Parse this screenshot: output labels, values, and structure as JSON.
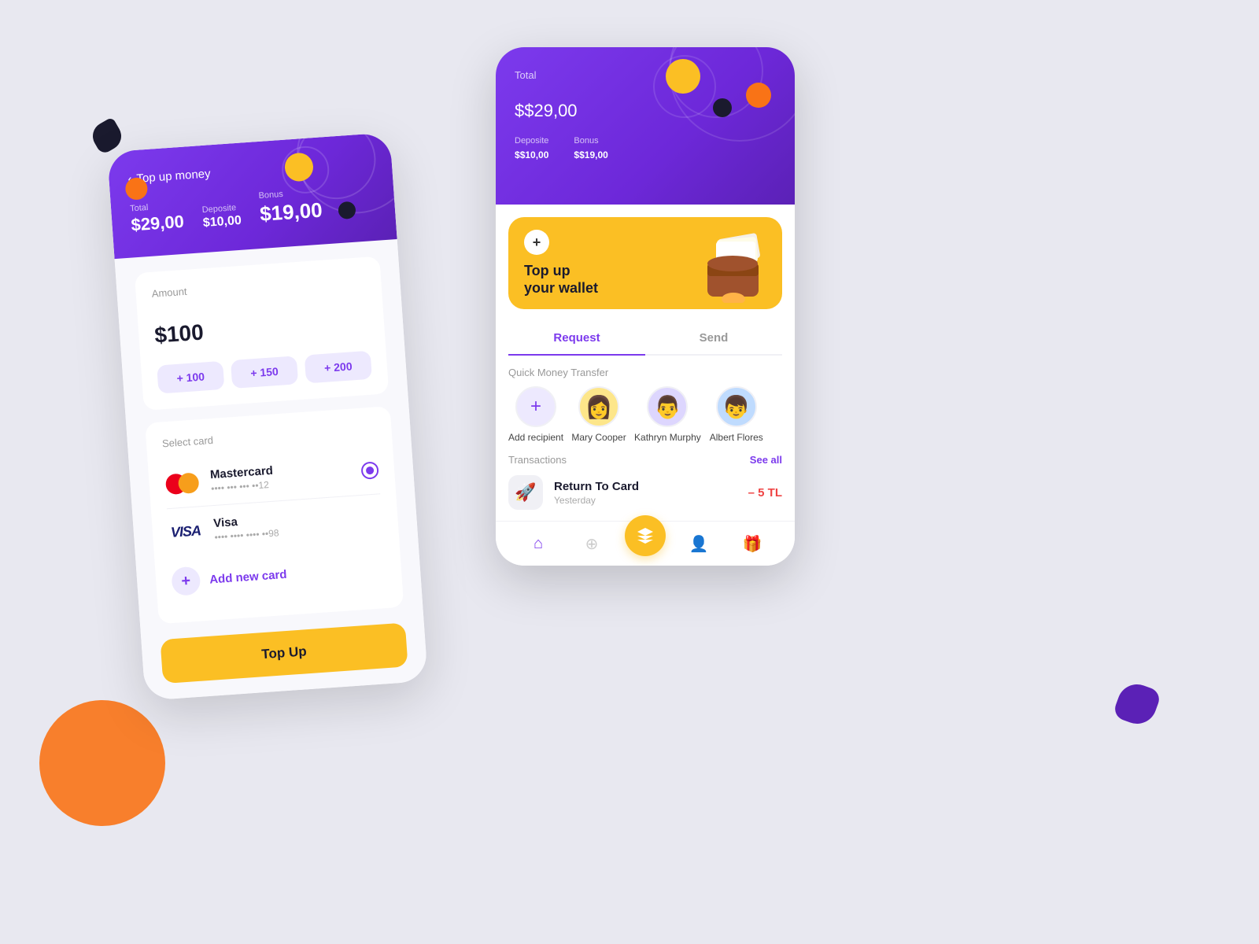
{
  "page": {
    "bg_color": "#e8e8f0"
  },
  "left_phone": {
    "header": {
      "back_label": "Top up money",
      "total_label": "Total",
      "total_value": "$29,00",
      "deposit_label": "Deposite",
      "deposit_value": "$10,00",
      "bonus_label": "Bonus",
      "bonus_value": "$19,00"
    },
    "amount": {
      "label": "Amount",
      "value": "$100",
      "dollar_sign": "$",
      "number": "100",
      "btn1": "+ 100",
      "btn2": "+ 150",
      "btn3": "+ 200"
    },
    "select_card": {
      "label": "Select card",
      "cards": [
        {
          "name": "Mastercard",
          "number": "•••• ••• ••• ••12",
          "type": "mastercard"
        },
        {
          "name": "Visa",
          "number": "•••• •••• •••• ••98",
          "type": "visa"
        }
      ],
      "add_card_label": "Add new card"
    },
    "topup_btn": "Top Up"
  },
  "right_phone": {
    "header": {
      "total_label": "Total",
      "total_value": "$29,00",
      "deposit_label": "Deposite",
      "deposit_value": "$10,00",
      "bonus_label": "Bonus",
      "bonus_value": "$19,00"
    },
    "wallet_card": {
      "plus": "+",
      "title_line1": "Top up",
      "title_line2": "your wallet"
    },
    "tabs": [
      {
        "label": "Request",
        "active": true
      },
      {
        "label": "Send",
        "active": false
      }
    ],
    "quick_transfer": {
      "label": "Quick Money Transfer",
      "add_recipient_label": "Add recipient",
      "recipients": [
        {
          "name": "Mary Cooper",
          "emoji": "👩"
        },
        {
          "name": "Kathryn Murphy",
          "emoji": "👨"
        },
        {
          "name": "Albert Flores",
          "emoji": "👦"
        }
      ]
    },
    "transactions": {
      "label": "Transactions",
      "see_all": "See all",
      "items": [
        {
          "name": "Return To Card",
          "date": "Yesterday",
          "amount": "– 5 TL",
          "icon": "🚀"
        }
      ]
    },
    "bottom_nav": {
      "items": [
        {
          "icon": "🏠",
          "active": true
        },
        {
          "icon": "🔍",
          "active": false
        },
        {
          "icon": "⬆",
          "center": true
        },
        {
          "icon": "👤",
          "active": false
        },
        {
          "icon": "🎁",
          "active": false
        }
      ]
    }
  }
}
